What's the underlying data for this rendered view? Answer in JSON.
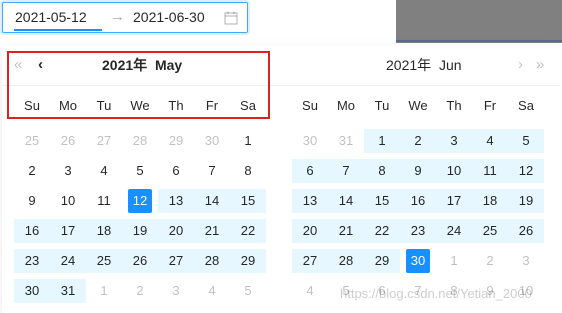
{
  "range_input": {
    "start_value": "2021-05-12",
    "end_value": "2021-06-30",
    "separator": "→",
    "calendar_icon": "calendar-icon"
  },
  "left_panel": {
    "year": "2021年",
    "month": "May",
    "prev_year_icon": "«",
    "prev_month_icon": "‹",
    "weekdays": [
      "Su",
      "Mo",
      "Tu",
      "We",
      "Th",
      "Fr",
      "Sa"
    ],
    "weeks": [
      [
        {
          "d": "25",
          "s": "out"
        },
        {
          "d": "26",
          "s": "out"
        },
        {
          "d": "27",
          "s": "out"
        },
        {
          "d": "28",
          "s": "out"
        },
        {
          "d": "29",
          "s": "out"
        },
        {
          "d": "30",
          "s": "out"
        },
        {
          "d": "1",
          "s": ""
        }
      ],
      [
        {
          "d": "2",
          "s": ""
        },
        {
          "d": "3",
          "s": ""
        },
        {
          "d": "4",
          "s": ""
        },
        {
          "d": "5",
          "s": ""
        },
        {
          "d": "6",
          "s": ""
        },
        {
          "d": "7",
          "s": ""
        },
        {
          "d": "8",
          "s": ""
        }
      ],
      [
        {
          "d": "9",
          "s": ""
        },
        {
          "d": "10",
          "s": ""
        },
        {
          "d": "11",
          "s": ""
        },
        {
          "d": "12",
          "s": "sel"
        },
        {
          "d": "13",
          "s": "range"
        },
        {
          "d": "14",
          "s": "range"
        },
        {
          "d": "15",
          "s": "range"
        }
      ],
      [
        {
          "d": "16",
          "s": "range"
        },
        {
          "d": "17",
          "s": "range"
        },
        {
          "d": "18",
          "s": "range"
        },
        {
          "d": "19",
          "s": "range"
        },
        {
          "d": "20",
          "s": "range"
        },
        {
          "d": "21",
          "s": "range"
        },
        {
          "d": "22",
          "s": "range"
        }
      ],
      [
        {
          "d": "23",
          "s": "range"
        },
        {
          "d": "24",
          "s": "range"
        },
        {
          "d": "25",
          "s": "range"
        },
        {
          "d": "26",
          "s": "range"
        },
        {
          "d": "27",
          "s": "range"
        },
        {
          "d": "28",
          "s": "range"
        },
        {
          "d": "29",
          "s": "range"
        }
      ],
      [
        {
          "d": "30",
          "s": "range"
        },
        {
          "d": "31",
          "s": "range"
        },
        {
          "d": "1",
          "s": "out"
        },
        {
          "d": "2",
          "s": "out"
        },
        {
          "d": "3",
          "s": "out"
        },
        {
          "d": "4",
          "s": "out"
        },
        {
          "d": "5",
          "s": "out"
        }
      ]
    ]
  },
  "right_panel": {
    "year": "2021年",
    "month": "Jun",
    "next_month_icon": "›",
    "next_year_icon": "»",
    "weekdays": [
      "Su",
      "Mo",
      "Tu",
      "We",
      "Th",
      "Fr",
      "Sa"
    ],
    "weeks": [
      [
        {
          "d": "30",
          "s": "out"
        },
        {
          "d": "31",
          "s": "out"
        },
        {
          "d": "1",
          "s": "range"
        },
        {
          "d": "2",
          "s": "range"
        },
        {
          "d": "3",
          "s": "range"
        },
        {
          "d": "4",
          "s": "range"
        },
        {
          "d": "5",
          "s": "range"
        }
      ],
      [
        {
          "d": "6",
          "s": "range"
        },
        {
          "d": "7",
          "s": "range"
        },
        {
          "d": "8",
          "s": "range"
        },
        {
          "d": "9",
          "s": "range"
        },
        {
          "d": "10",
          "s": "range"
        },
        {
          "d": "11",
          "s": "range"
        },
        {
          "d": "12",
          "s": "range"
        }
      ],
      [
        {
          "d": "13",
          "s": "range"
        },
        {
          "d": "14",
          "s": "range"
        },
        {
          "d": "15",
          "s": "range"
        },
        {
          "d": "16",
          "s": "range"
        },
        {
          "d": "17",
          "s": "range"
        },
        {
          "d": "18",
          "s": "range"
        },
        {
          "d": "19",
          "s": "range"
        }
      ],
      [
        {
          "d": "20",
          "s": "range"
        },
        {
          "d": "21",
          "s": "range"
        },
        {
          "d": "22",
          "s": "range"
        },
        {
          "d": "23",
          "s": "range"
        },
        {
          "d": "24",
          "s": "range"
        },
        {
          "d": "25",
          "s": "range"
        },
        {
          "d": "26",
          "s": "range"
        }
      ],
      [
        {
          "d": "27",
          "s": "range"
        },
        {
          "d": "28",
          "s": "range"
        },
        {
          "d": "29",
          "s": "range"
        },
        {
          "d": "30",
          "s": "sel"
        },
        {
          "d": "1",
          "s": "out"
        },
        {
          "d": "2",
          "s": "out"
        },
        {
          "d": "3",
          "s": "out"
        }
      ],
      [
        {
          "d": "4",
          "s": "out"
        },
        {
          "d": "5",
          "s": "out"
        },
        {
          "d": "6",
          "s": "out"
        },
        {
          "d": "7",
          "s": "out"
        },
        {
          "d": "8",
          "s": "out"
        },
        {
          "d": "9",
          "s": "out"
        },
        {
          "d": "10",
          "s": "out"
        }
      ]
    ]
  },
  "watermark": "https://blog.csdn.net/Yetian_2000",
  "colors": {
    "accent": "#1890ff",
    "range_bg": "#e6f7ff",
    "annotation_box": "#e02020"
  }
}
